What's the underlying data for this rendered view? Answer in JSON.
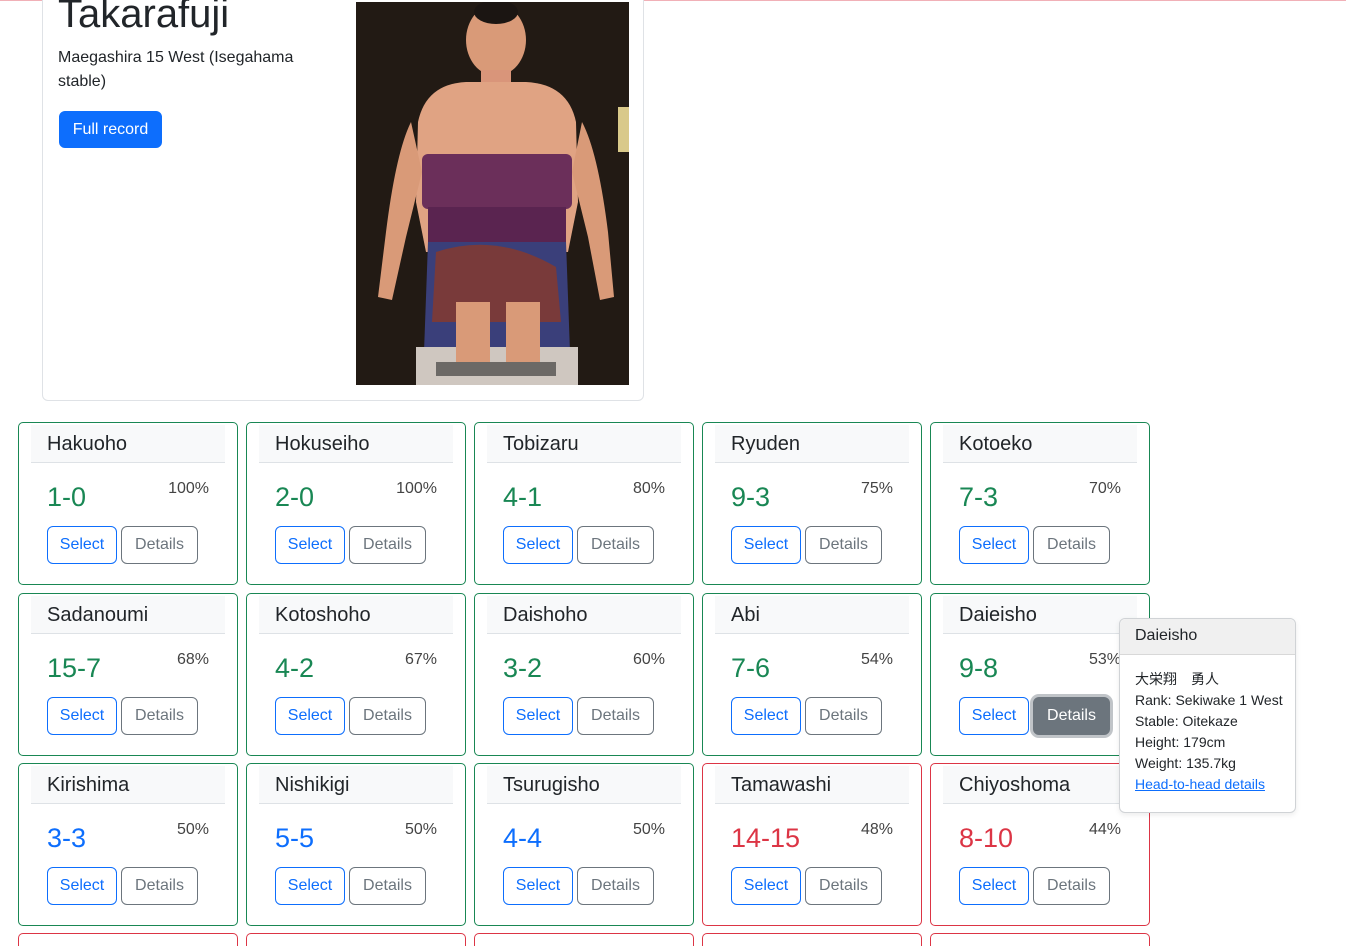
{
  "hero": {
    "name": "Takarafuji",
    "rank": "Maegashira 15 West (Isegahama stable)",
    "full_record_label": "Full record"
  },
  "buttons": {
    "select": "Select",
    "details": "Details"
  },
  "cards": [
    {
      "name": "Hakuoho",
      "record": "1-0",
      "pct": "100%",
      "status": "win"
    },
    {
      "name": "Hokuseiho",
      "record": "2-0",
      "pct": "100%",
      "status": "win"
    },
    {
      "name": "Tobizaru",
      "record": "4-1",
      "pct": "80%",
      "status": "win"
    },
    {
      "name": "Ryuden",
      "record": "9-3",
      "pct": "75%",
      "status": "win"
    },
    {
      "name": "Kotoeko",
      "record": "7-3",
      "pct": "70%",
      "status": "win"
    },
    {
      "name": "Sadanoumi",
      "record": "15-7",
      "pct": "68%",
      "status": "win"
    },
    {
      "name": "Kotoshoho",
      "record": "4-2",
      "pct": "67%",
      "status": "win"
    },
    {
      "name": "Daishoho",
      "record": "3-2",
      "pct": "60%",
      "status": "win"
    },
    {
      "name": "Abi",
      "record": "7-6",
      "pct": "54%",
      "status": "win"
    },
    {
      "name": "Daieisho",
      "record": "9-8",
      "pct": "53%",
      "status": "win"
    },
    {
      "name": "Kirishima",
      "record": "3-3",
      "pct": "50%",
      "status": "even"
    },
    {
      "name": "Nishikigi",
      "record": "5-5",
      "pct": "50%",
      "status": "even"
    },
    {
      "name": "Tsurugisho",
      "record": "4-4",
      "pct": "50%",
      "status": "even"
    },
    {
      "name": "Tamawashi",
      "record": "14-15",
      "pct": "48%",
      "status": "loss"
    },
    {
      "name": "Chiyoshoma",
      "record": "8-10",
      "pct": "44%",
      "status": "loss"
    }
  ],
  "popover": {
    "title": "Daieisho",
    "kanji": "大栄翔　勇人",
    "rank": "Rank: Sekiwake 1 West",
    "stable": "Stable: Oitekaze",
    "height": "Height: 179cm",
    "weight": "Weight: 135.7kg",
    "link": "Head-to-head details"
  },
  "colors": {
    "win": "#198754",
    "even": "#0d6efd",
    "loss": "#dc3545",
    "primary": "#0d6efd",
    "secondary": "#6c757d"
  }
}
